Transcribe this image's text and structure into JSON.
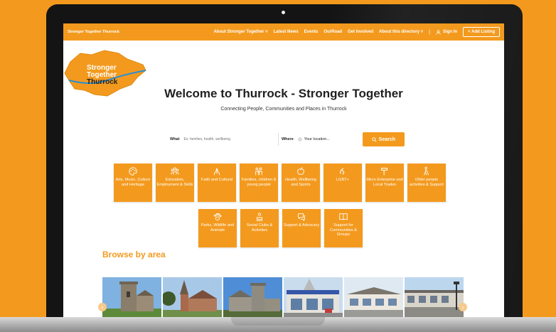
{
  "nav": {
    "brand": "Stronger Together Thurrock",
    "items": [
      {
        "label": "About Stronger Together ˅"
      },
      {
        "label": "Latest News"
      },
      {
        "label": "Events"
      },
      {
        "label": "OurRoad"
      },
      {
        "label": "Get Involved"
      },
      {
        "label": "About this directory ˅"
      }
    ],
    "separator": "|",
    "sign_in": "Sign In",
    "add_listing": "+ Add Listing"
  },
  "logo": {
    "line1": "Stronger",
    "line2": "Together",
    "line3": "Thurrock"
  },
  "hero": {
    "title": "Welcome to Thurrock - Stronger Together",
    "subtitle": "Connecting People, Communities and Places in Thurrock"
  },
  "search": {
    "what_label": "What",
    "what_placeholder": "Ex: families, health, wellbeing",
    "where_label": "Where",
    "location_text": "Your location...",
    "button_label": "Search"
  },
  "categories": [
    {
      "label": "Arts, Music, Culture and Heritage",
      "icon": "palette-icon"
    },
    {
      "label": "Education, Employment & Skills",
      "icon": "people-group-icon"
    },
    {
      "label": "Faith and Cultural",
      "icon": "praying-hands-icon"
    },
    {
      "label": "Families, children & young people",
      "icon": "family-icon"
    },
    {
      "label": "Health, Wellbeing and Sports",
      "icon": "apple-icon"
    },
    {
      "label": "LGBT+",
      "icon": "rainbow-hand-icon"
    },
    {
      "label": "Micro Enterprise and Local Trades",
      "icon": "hammer-icon"
    },
    {
      "label": "Older people activities & Support",
      "icon": "walking-elder-icon"
    },
    {
      "label": "Parks, Wildlife and Animals",
      "icon": "paw-icon"
    },
    {
      "label": "Social Clubs & Activities",
      "icon": "social-group-icon"
    },
    {
      "label": "Support & Advocacy",
      "icon": "chat-support-icon"
    },
    {
      "label": "Support for Communities & Groups",
      "icon": "book-icon"
    }
  ],
  "browse": {
    "title": "Browse by area"
  },
  "colors": {
    "accent": "#f39a1e",
    "bezel": "#141414",
    "text_dark": "#1f1f1f"
  }
}
